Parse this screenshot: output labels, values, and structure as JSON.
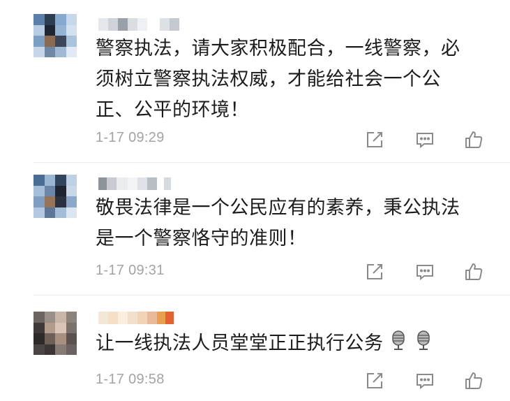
{
  "comments": [
    {
      "text_lines": [
        "警察执法，请大家积极配合，一线警察，必",
        "须树立警察执法权威，才能给社会一个公",
        "正、公平的环境！"
      ],
      "time": "1-17 09:29"
    },
    {
      "text_lines": [
        "敬畏法律是一个公民应有的素养，秉公执法",
        "是一个警察恪守的准则！"
      ],
      "time": "1-17 09:31"
    },
    {
      "text_lines": [
        "让一线执法人员堂堂正正执行公务"
      ],
      "emojis": [
        "microphone-icon",
        "microphone-icon"
      ],
      "time": "1-17 09:58"
    }
  ],
  "colors": {
    "text": "#1c1c1c",
    "meta": "#a3a3a3",
    "icon": "#8a8a8a"
  },
  "icons": [
    "share-icon",
    "reply-icon",
    "like-icon"
  ]
}
